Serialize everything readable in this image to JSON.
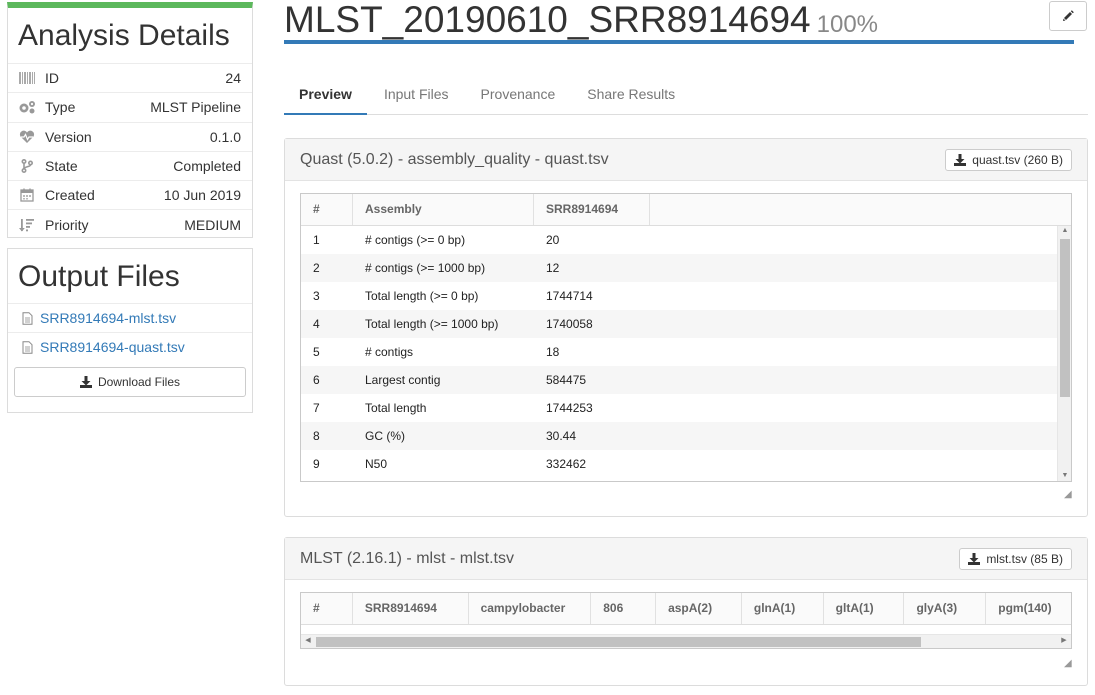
{
  "details": {
    "title": "Analysis Details",
    "rows": [
      {
        "icon": "barcode-icon",
        "label": "ID",
        "value": "24"
      },
      {
        "icon": "cogs-icon",
        "label": "Type",
        "value": "MLST Pipeline"
      },
      {
        "icon": "heartbeat-icon",
        "label": "Version",
        "value": "0.1.0"
      },
      {
        "icon": "branch-icon",
        "label": "State",
        "value": "Completed"
      },
      {
        "icon": "calendar-icon",
        "label": "Created",
        "value": "10 Jun 2019"
      },
      {
        "icon": "sort-amount-icon",
        "label": "Priority",
        "value": "MEDIUM"
      }
    ]
  },
  "output_files": {
    "title": "Output Files",
    "files": [
      "SRR8914694-mlst.tsv",
      "SRR8914694-quast.tsv"
    ],
    "download_label": "Download Files"
  },
  "analysis": {
    "name": "MLST_20190610_SRR8914694",
    "progress": "100%"
  },
  "tabs": [
    "Preview",
    "Input Files",
    "Provenance",
    "Share Results"
  ],
  "quast": {
    "title": "Quast (5.0.2) - assembly_quality - quast.tsv",
    "file_button": "quast.tsv (260 B)",
    "columns": [
      "#",
      "Assembly",
      "SRR8914694"
    ],
    "rows": [
      [
        "1",
        "# contigs (>= 0 bp)",
        "20"
      ],
      [
        "2",
        "# contigs (>= 1000 bp)",
        "12"
      ],
      [
        "3",
        "Total length (>= 0 bp)",
        "1744714"
      ],
      [
        "4",
        "Total length (>= 1000 bp)",
        "1740058"
      ],
      [
        "5",
        "# contigs",
        "18"
      ],
      [
        "6",
        "Largest contig",
        "584475"
      ],
      [
        "7",
        "Total length",
        "1744253"
      ],
      [
        "8",
        "GC (%)",
        "30.44"
      ],
      [
        "9",
        "N50",
        "332462"
      ]
    ]
  },
  "mlst": {
    "title": "MLST (2.16.1) - mlst - mlst.tsv",
    "file_button": "mlst.tsv (85 B)",
    "columns": [
      "#",
      "SRR8914694",
      "campylobacter",
      "806",
      "aspA(2)",
      "glnA(1)",
      "gltA(1)",
      "glyA(3)",
      "pgm(140)"
    ]
  },
  "colors": {
    "accent": "#337ab7",
    "success_bar": "#5cb85c",
    "link": "#337ab7"
  }
}
